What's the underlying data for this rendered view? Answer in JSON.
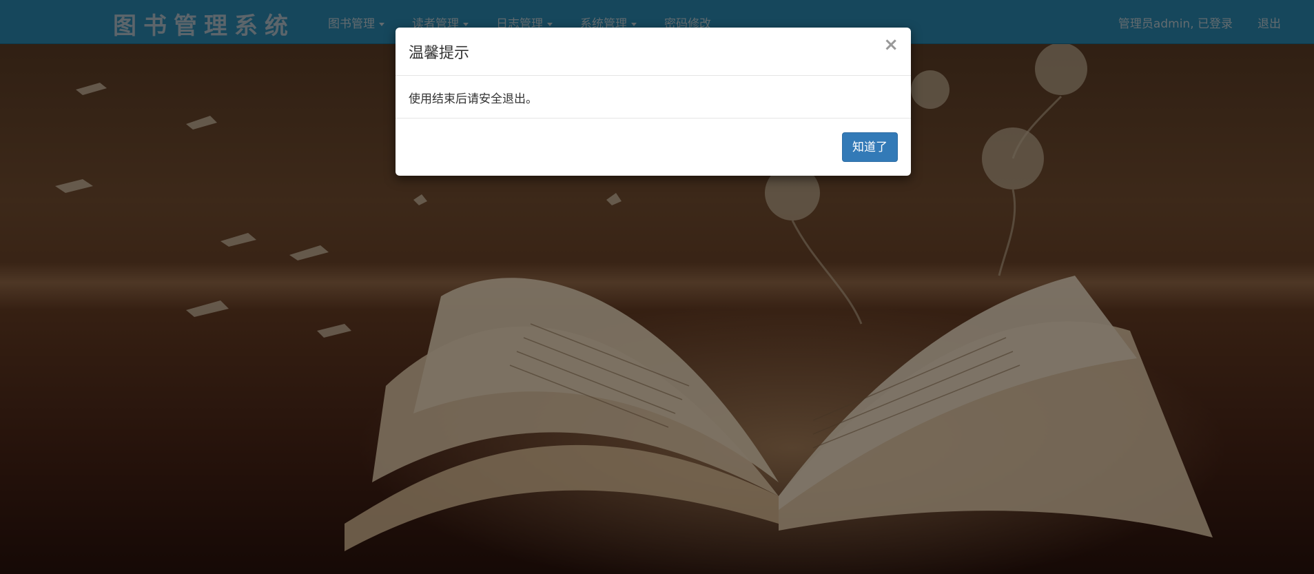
{
  "app": {
    "brand": "图书管理系统"
  },
  "navbar": {
    "menu": [
      {
        "label": "图书管理",
        "has_dropdown": true
      },
      {
        "label": "读者管理",
        "has_dropdown": true
      },
      {
        "label": "日志管理",
        "has_dropdown": true
      },
      {
        "label": "系统管理",
        "has_dropdown": true
      },
      {
        "label": "密码修改",
        "has_dropdown": false
      }
    ],
    "user_status": "管理员admin, 已登录",
    "logout": "退出"
  },
  "modal": {
    "title": "温馨提示",
    "close_glyph": "×",
    "message": "使用结束后请安全退出。",
    "confirm_button": "知道了"
  },
  "colors": {
    "navbar": "#2c8fb8",
    "primary_button": "#337ab7"
  }
}
